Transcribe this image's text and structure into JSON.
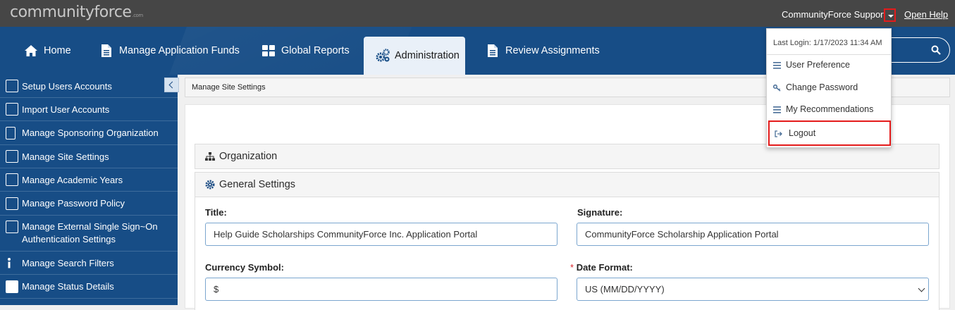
{
  "top_bar": {
    "logo_text": "communityforce",
    "logo_sub": ".com",
    "user_name": "CommunityForce Support",
    "help_link": "Open Help"
  },
  "nav": {
    "items": [
      {
        "label": "Home",
        "icon": "home-icon"
      },
      {
        "label": "Manage Application Funds",
        "icon": "document-icon"
      },
      {
        "label": "Global Reports",
        "icon": "grid-icon"
      },
      {
        "label": "Administration",
        "icon": "gears-icon",
        "active": true
      },
      {
        "label": "Review Assignments",
        "icon": "document-icon"
      }
    ]
  },
  "sidebar": {
    "items": [
      {
        "label": "Setup Users Accounts"
      },
      {
        "label": "Import User Accounts"
      },
      {
        "label": "Manage Sponsoring Organization"
      },
      {
        "label": "Manage Site Settings"
      },
      {
        "label": "Manage Academic Years"
      },
      {
        "label": "Manage Password Policy"
      },
      {
        "label": "Manage External Single Sign~On Authentication Settings"
      },
      {
        "label": "Manage Search Filters"
      },
      {
        "label": "Manage Status Details"
      }
    ]
  },
  "breadcrumb": "Manage Site Settings",
  "sections": {
    "organization": "Organization",
    "general": "General Settings"
  },
  "form": {
    "title_label": "Title:",
    "title_value": "Help Guide Scholarships CommunityForce Inc. Application Portal",
    "signature_label": "Signature:",
    "signature_value": "CommunityForce Scholarship Application Portal",
    "currency_label": "Currency Symbol:",
    "currency_value": "$",
    "date_format_required": "*",
    "date_format_label": "Date Format:",
    "date_format_value": "US (MM/DD/YYYY)"
  },
  "dropdown": {
    "last_login": "Last Login: 1/17/2023 11:34 AM",
    "items": [
      {
        "label": "User Preference"
      },
      {
        "label": "Change Password"
      },
      {
        "label": "My Recommendations"
      },
      {
        "label": "Logout"
      }
    ]
  },
  "colors": {
    "top_bar": "#464646",
    "nav": "#174d86",
    "highlight": "#e41b1b"
  }
}
